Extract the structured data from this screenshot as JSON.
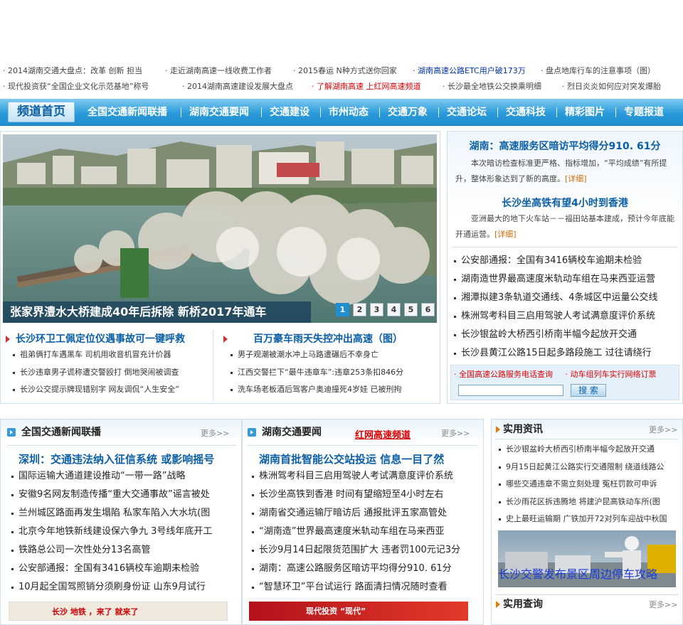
{
  "ticker": {
    "row1": [
      {
        "text": "2014湖南交通大盘点：改革 创新 担当",
        "style": ""
      },
      {
        "text": "走近湖南高速一线收费工作者",
        "style": ""
      },
      {
        "text": "2015春运 N种方式送你回家",
        "style": ""
      },
      {
        "text": "湖南高速公路ETC用户破173万",
        "style": "blue"
      },
      {
        "text": "盘点地库行车的注意事项（图）",
        "style": ""
      }
    ],
    "row2": [
      {
        "text": "现代投资获“全国企业文化示范基地”称号",
        "style": ""
      },
      {
        "text": "2014湖南高速建设发展大盘点",
        "style": ""
      },
      {
        "text": "了解湖南高速 上红网高速频道",
        "style": "red"
      },
      {
        "text": "长沙最全地铁公交换乘明细",
        "style": ""
      },
      {
        "text": "烈日炎炎如何应对突发爆胎",
        "style": ""
      }
    ]
  },
  "nav": {
    "home": "频道首页",
    "items": [
      "全国交通新闻联播",
      "湖南交通要闻",
      "交通建设",
      "市州动态",
      "交通万象",
      "交通论坛",
      "交通科技",
      "精彩图片",
      "专题报道"
    ]
  },
  "slider": {
    "caption": "张家界澧水大桥建成40年后拆除 新桥2017年通车",
    "pages": [
      "1",
      "2",
      "3",
      "4",
      "5",
      "6"
    ],
    "active": 0
  },
  "below_slider": {
    "left": {
      "headline": "长沙环卫工佩定位仪遇事故可一键呼救",
      "items": [
        "祖弟俩打车遇黑车 司机用收音机冒充计价器",
        "长沙违章男子谎称遭交警殴打 倒地哭闹被调查",
        "长沙公交提示牌现错别字 网友调侃“人生安全”"
      ]
    },
    "right": {
      "headline": "百万豪车雨天失控冲出高速（图）",
      "items": [
        "男子观潮被潮水冲上马路遭碾后不幸身亡",
        "江西交警拦下“最牛违章车”:违章253条扣846分",
        "洗车场老板酒后驾客户奥迪撞死4岁娃 已被刑拘"
      ]
    }
  },
  "right_top": {
    "story1": {
      "title": "湖南：高速服务区暗访平均得分910. 61分",
      "body": "本次暗访检查标准更严格、指标增加，“平均成绩”有所提升，整体形象达到了新的高度。",
      "more": "[详细]"
    },
    "story2": {
      "title": "长沙坐高铁有望4小时到香港",
      "body": "亚洲最大的地下火车站－－福田站基本建成，预计今年底能开通运营。",
      "more": "[详细]"
    },
    "items": [
      "公安部通报：全国有3416辆校车逾期未检验",
      "湖南造世界最高速度米轨动车组在马来西亚运营",
      "湘潭拟建3条轨道交通线、4条城区中运量公交线",
      "株洲驾考科目三启用驾驶人考试满意度评价系统",
      "长沙银盆岭大桥西引桥南半幅今起放开交通",
      "长沙县黄江公路15日起多路段施工 过往请绕行"
    ],
    "links": [
      "全国高速公路服务电话查询",
      "动车组列车实行网络订票"
    ],
    "search_placeholder": "",
    "search_button": "搜 索"
  },
  "national": {
    "title": "全国交通新闻联播",
    "more": "更多>>",
    "headline": "深圳：交通违法纳入征信系统 或影响摇号",
    "items": [
      "国际运输大通道建设推动“一带一路”战略",
      "安徽9名网友制造传播“重大交通事故”谣言被处",
      "兰州城区路面再发生塌陷 私家车陷入大水坑(图",
      "北京今年地铁新线建设保六争九 3号线年底开工",
      "铁路总公司一次性处分13名高管",
      "公安部通报：全国有3416辆校车逾期未检验",
      "10月起全国驾照销分须刷身份证 山东9月试行"
    ],
    "banner": "长沙 地铁 ，来了 就来了"
  },
  "hunan": {
    "title": "湖南交通要闻",
    "badge": "红网高速频道",
    "more": "更多>>",
    "headline": "湖南首批智能公交站投运 信息一目了然",
    "items": [
      "株洲驾考科目三启用驾驶人考试满意度评价系统",
      "长沙坐高铁到香港 时间有望缩短至4小时左右",
      "湖南省交通运输厅暗访后 通报批评五家高管处",
      "“湖南造”世界最高速度米轨动车组在马来西亚",
      "长沙9月14日起限货范围扩大 违者罚100元记3分",
      "湖南：高速公路服务区暗访平均得分910. 61分",
      "“智慧环卫”平台试运行 路面清扫情况随时查看"
    ],
    "banner": "现代投资 “现代”"
  },
  "practical": {
    "title": "实用资讯",
    "more": "更多>>",
    "items": [
      "长沙银盆岭大桥西引桥南半幅今起放开交通",
      "9月15日起黄江公路实行交通限制 绕道线路公",
      "哪些交通违章不需立刻处理 冤枉罚款可申诉",
      "长沙雨花区拆违腾地 将建沪昆高铁动车所(图",
      "史上最旺运输期 广铁加开72对列车迎战中秋国"
    ],
    "photo_caption": "长沙交警发布景区周边停车攻略",
    "query_title": "实用查询",
    "query_more": "更多>>"
  },
  "colors": {
    "nav": "#1f8fd0",
    "accent_blue": "#0a5fa6",
    "red": "#dd0000"
  }
}
